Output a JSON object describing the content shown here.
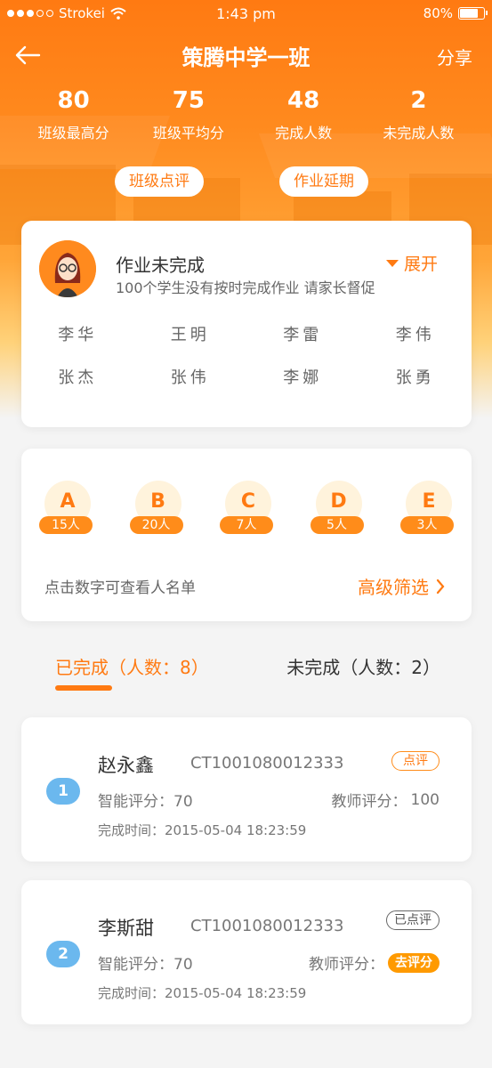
{
  "status_bar": {
    "carrier": "Strokei",
    "time": "1:43 pm",
    "battery_percent": "80%",
    "battery_level": 0.8
  },
  "nav": {
    "title": "策腾中学一班",
    "share": "分享"
  },
  "stats": [
    {
      "value": "80",
      "label": "班级最高分"
    },
    {
      "value": "75",
      "label": "班级平均分"
    },
    {
      "value": "48",
      "label": "完成人数"
    },
    {
      "value": "2",
      "label": "未完成人数"
    }
  ],
  "actions": {
    "class_review": "班级点评",
    "homework_delay": "作业延期"
  },
  "unfinished": {
    "title": "作业未完成",
    "desc": "100个学生没有按时完成作业 请家长督促",
    "expand": "展开",
    "names": [
      "李华",
      "王明",
      "李雷",
      "李伟",
      "张杰",
      "张伟",
      "李娜",
      "张勇"
    ]
  },
  "grades": [
    {
      "letter": "A",
      "count": "15人"
    },
    {
      "letter": "B",
      "count": "20人"
    },
    {
      "letter": "C",
      "count": "7人"
    },
    {
      "letter": "D",
      "count": "5人"
    },
    {
      "letter": "E",
      "count": "3人"
    }
  ],
  "grade_hint": "点击数字可查看人名单",
  "advanced_filter": "高级筛选",
  "tabs": {
    "done": "已完成（人数：8）",
    "not_done": "未完成（人数：2）"
  },
  "records": [
    {
      "index": "1",
      "name": "赵永鑫",
      "id": "CT1001080012333",
      "tag": "点评",
      "smart_score": "智能评分：70",
      "teacher_label": "教师评分：",
      "teacher_value": "100",
      "time": "完成时间：2015-05-04 18:23:59"
    },
    {
      "index": "2",
      "name": "李斯甜",
      "id": "CT1001080012333",
      "tag": "已点评",
      "smart_score": "智能评分：70",
      "teacher_label": "教师评分：",
      "teacher_action": "去评分",
      "time": "完成时间：2015-05-04 18:23:59"
    }
  ],
  "colors": {
    "accent": "#ff7a12",
    "index_blue": "#6bb8ee"
  }
}
